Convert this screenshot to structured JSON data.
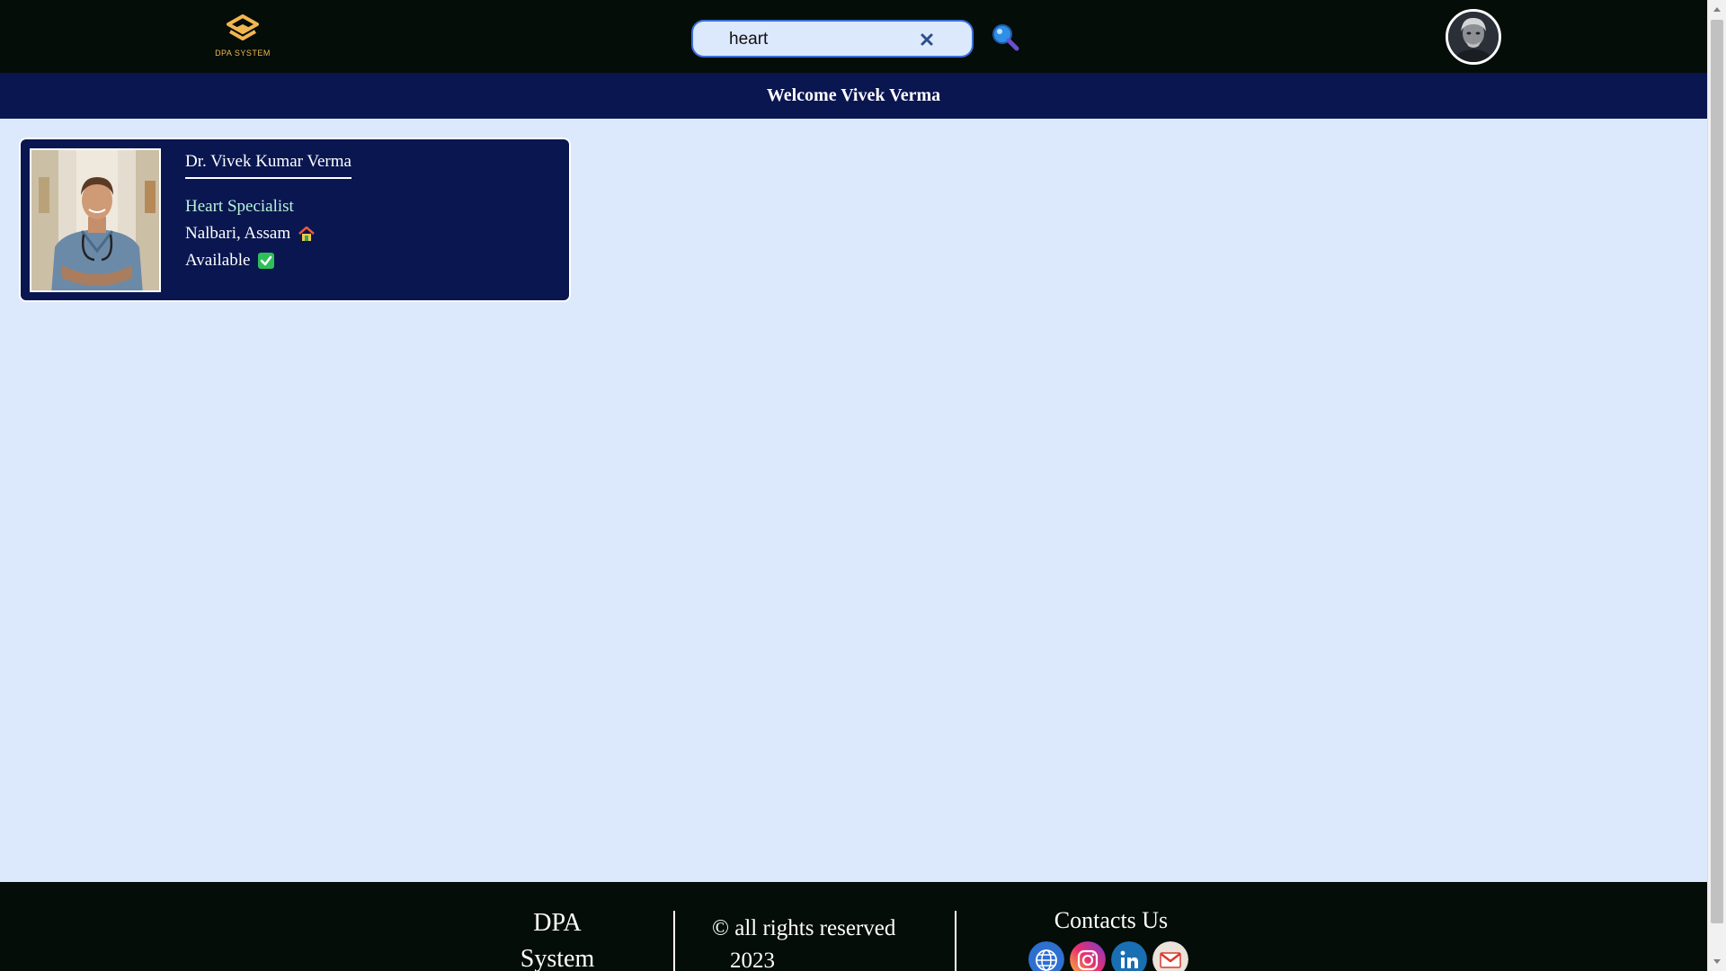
{
  "header": {
    "logo_text": "DPA SYSTEM",
    "search": {
      "value": "heart",
      "placeholder": ""
    },
    "clear_icon": "close-icon",
    "search_icon": "magnifier-icon",
    "accent_color": "#3a6fd8"
  },
  "welcome": {
    "text": "Welcome Vivek Verma"
  },
  "results": [
    {
      "name": "Dr. Vivek Kumar Verma",
      "specialty": "Heart Specialist",
      "location": "Nalbari, Assam",
      "status": "Available",
      "location_icon": "home-icon",
      "status_icon": "check-icon"
    }
  ],
  "footer": {
    "brand": "DPA System",
    "copyright": "© all rights reserved",
    "year": "2023",
    "contacts_title": "Contacts Us",
    "social_icons": [
      "globe-icon",
      "instagram-icon",
      "linkedin-icon",
      "gmail-icon"
    ]
  },
  "colors": {
    "topbar": "#040d08",
    "navy": "#0a1650",
    "page_bg": "#dce8fb",
    "specialty_text": "#b9f3d9",
    "logo_gold": "#f2b650"
  }
}
